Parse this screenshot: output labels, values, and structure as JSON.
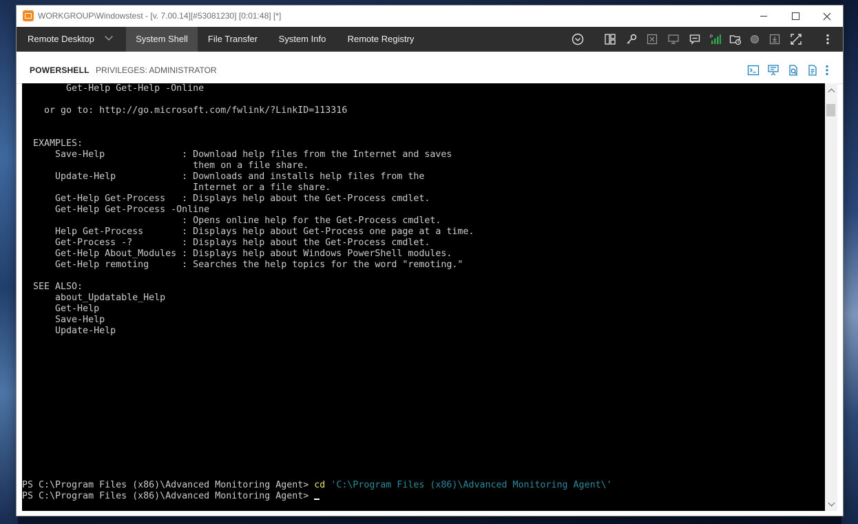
{
  "window": {
    "title": "WORKGROUP\\Windowstest -  [v. 7.00.14][#53081230] [0:01:48] [*]"
  },
  "nav": {
    "tabs": [
      {
        "label": "Remote Desktop"
      },
      {
        "label": "System Shell"
      },
      {
        "label": "File Transfer"
      },
      {
        "label": "System Info"
      },
      {
        "label": "Remote Registry"
      }
    ],
    "active_tab": "System Shell",
    "toolbar_icons": [
      "chevron-circle-icon",
      "layout-icon",
      "key-icon",
      "grid-x-icon",
      "monitor-icon",
      "chat-icon",
      "signal-bars-icon",
      "folder-clock-icon",
      "record-dot-icon",
      "download-icon",
      "fullscreen-icon",
      "more-vertical-icon"
    ]
  },
  "panel": {
    "title": "POWERSHELL",
    "privileges": "PRIVILEGES: ADMINISTRATOR",
    "icons": [
      "terminal-icon",
      "presentation-icon",
      "search-document-icon",
      "document-icon",
      "more-vertical-icon"
    ]
  },
  "console": {
    "help_text": "        Get-Help Get-Help -Online\n\n    or go to: http://go.microsoft.com/fwlink/?LinkID=113316\n\n\n  EXAMPLES:\n      Save-Help              : Download help files from the Internet and saves\n                               them on a file share.\n      Update-Help            : Downloads and installs help files from the\n                               Internet or a file share.\n      Get-Help Get-Process   : Displays help about the Get-Process cmdlet.\n      Get-Help Get-Process -Online\n                             : Opens online help for the Get-Process cmdlet.\n      Help Get-Process       : Displays help about Get-Process one page at a time.\n      Get-Process -?         : Displays help about the Get-Process cmdlet.\n      Get-Help About_Modules : Displays help about Windows PowerShell modules.\n      Get-Help remoting      : Searches the help topics for the word \"remoting.\"\n\n  SEE ALSO:\n      about_Updatable_Help\n      Get-Help\n      Save-Help\n      Update-Help",
    "prompt1": "PS C:\\Program Files (x86)\\Advanced Monitoring Agent> ",
    "command_name": "cd",
    "command_arg": " 'C:\\Program Files (x86)\\Advanced Monitoring Agent\\'",
    "prompt2": "PS C:\\Program Files (x86)\\Advanced Monitoring Agent> "
  },
  "colors": {
    "navbar": "#2e2e2e",
    "active_tab": "#4a4a4a",
    "console_bg": "#000000",
    "console_fg": "#cccccc",
    "command_yellow": "#f0e26a",
    "string_teal": "#2c8a9a",
    "accent_blue": "#1f7fb8",
    "signal_green": "#2ea84a"
  }
}
